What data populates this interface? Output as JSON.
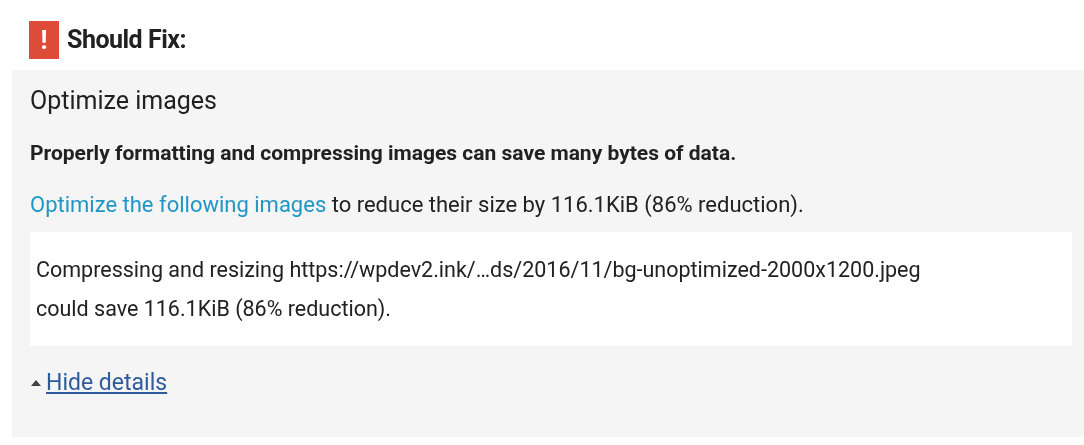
{
  "heading": {
    "icon": "!",
    "label": "Should Fix:"
  },
  "rule": {
    "title": "Optimize images",
    "summary": "Properly formatting and compressing images can save many bytes of data.",
    "link": "Optimize the following images",
    "link_rest": " to reduce their size by 116.1KiB (86% reduction).",
    "details": [
      "Compressing and resizing https://wpdev2.ink/…ds/2016/11/bg-unoptimized-2000x1200.jpeg",
      "could save 116.1KiB (86% reduction)."
    ],
    "toggle": {
      "label": "Hide details",
      "expanded": true
    }
  }
}
